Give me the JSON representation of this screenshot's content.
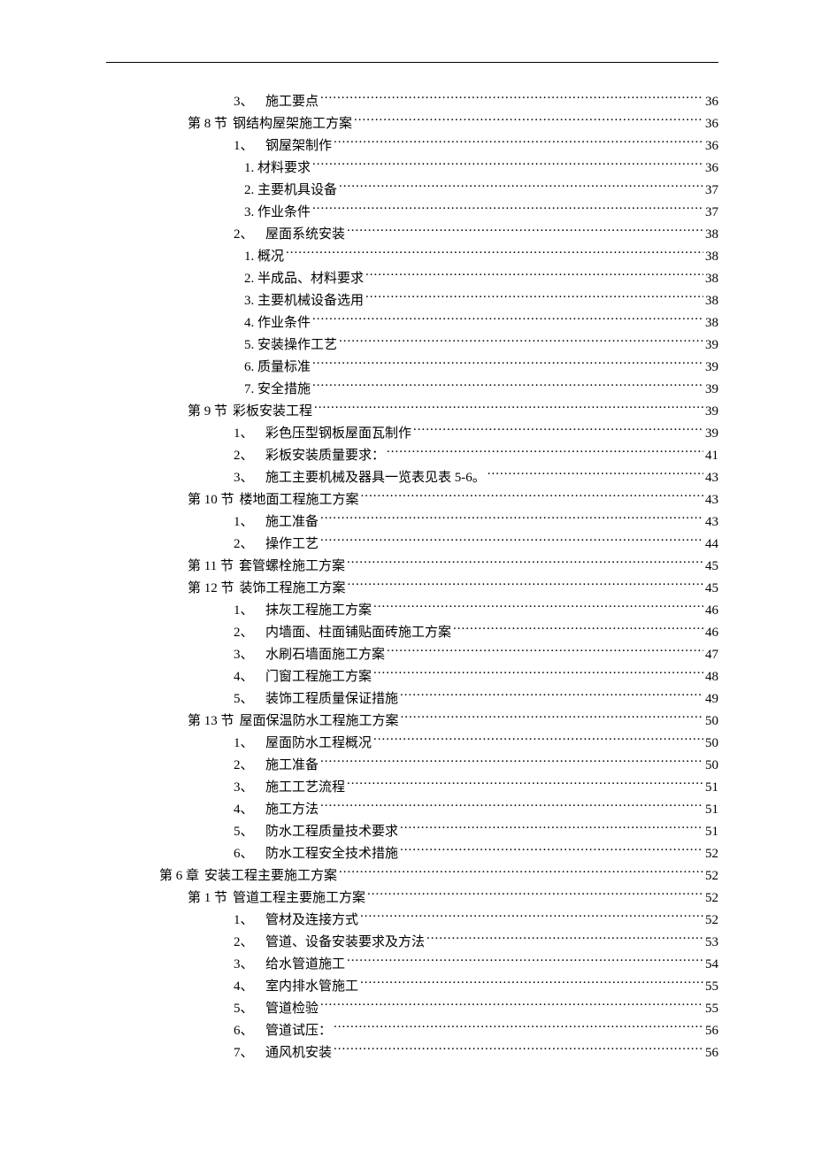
{
  "toc": [
    {
      "level": "l2b",
      "prefix": "3、",
      "title": "施工要点",
      "page": "36"
    },
    {
      "level": "l1",
      "prefix": "第 8 节",
      "title": "钢结构屋架施工方案",
      "page": "36"
    },
    {
      "level": "l2b",
      "prefix": "1、",
      "title": "钢屋架制作",
      "page": "36"
    },
    {
      "level": "l3",
      "prefix": "",
      "title": "1. 材料要求",
      "page": "36"
    },
    {
      "level": "l3",
      "prefix": "",
      "title": "2. 主要机具设备",
      "page": "37"
    },
    {
      "level": "l3",
      "prefix": "",
      "title": "3. 作业条件",
      "page": "37"
    },
    {
      "level": "l2b",
      "prefix": "2、",
      "title": "屋面系统安装",
      "page": "38"
    },
    {
      "level": "l3",
      "prefix": "",
      "title": "1. 概况",
      "page": "38"
    },
    {
      "level": "l3",
      "prefix": "",
      "title": "2. 半成品、材料要求",
      "page": "38"
    },
    {
      "level": "l3",
      "prefix": "",
      "title": "3. 主要机械设备选用",
      "page": "38"
    },
    {
      "level": "l3",
      "prefix": "",
      "title": "4. 作业条件",
      "page": "38"
    },
    {
      "level": "l3",
      "prefix": "",
      "title": "5. 安装操作工艺",
      "page": "39"
    },
    {
      "level": "l3",
      "prefix": "",
      "title": "6. 质量标准",
      "page": "39"
    },
    {
      "level": "l3",
      "prefix": "",
      "title": "7. 安全措施",
      "page": "39"
    },
    {
      "level": "l1",
      "prefix": "第 9 节",
      "title": "彩板安装工程",
      "page": "39"
    },
    {
      "level": "l2b",
      "prefix": "1、",
      "title": "彩色压型钢板屋面瓦制作",
      "page": "39"
    },
    {
      "level": "l2b",
      "prefix": "2、",
      "title": "彩板安装质量要求：",
      "page": "41"
    },
    {
      "level": "l2b",
      "prefix": "3、",
      "title": "施工主要机械及器具一览表见表 5-6。",
      "page": "43"
    },
    {
      "level": "l1",
      "prefix": "第 10 节",
      "title": "楼地面工程施工方案",
      "page": "43"
    },
    {
      "level": "l2b",
      "prefix": "1、",
      "title": "施工准备",
      "page": "43"
    },
    {
      "level": "l2b",
      "prefix": "2、",
      "title": "操作工艺",
      "page": "44"
    },
    {
      "level": "l1",
      "prefix": "第 11 节",
      "title": "套管螺栓施工方案",
      "page": "45"
    },
    {
      "level": "l1",
      "prefix": "第 12 节",
      "title": "装饰工程施工方案",
      "page": "45"
    },
    {
      "level": "l2b",
      "prefix": "1、",
      "title": "抹灰工程施工方案",
      "page": "46"
    },
    {
      "level": "l2b",
      "prefix": "2、",
      "title": "内墙面、柱面铺贴面砖施工方案",
      "page": "46"
    },
    {
      "level": "l2b",
      "prefix": "3、",
      "title": "水刷石墙面施工方案",
      "page": "47"
    },
    {
      "level": "l2b",
      "prefix": "4、",
      "title": "门窗工程施工方案",
      "page": "48"
    },
    {
      "level": "l2b",
      "prefix": "5、",
      "title": "装饰工程质量保证措施",
      "page": "49"
    },
    {
      "level": "l1",
      "prefix": "第 13 节",
      "title": "屋面保温防水工程施工方案",
      "page": "50"
    },
    {
      "level": "l2b",
      "prefix": "1、",
      "title": "屋面防水工程概况",
      "page": "50"
    },
    {
      "level": "l2b",
      "prefix": "2、",
      "title": "施工准备",
      "page": "50"
    },
    {
      "level": "l2b",
      "prefix": "3、",
      "title": "施工工艺流程",
      "page": "51"
    },
    {
      "level": "l2b",
      "prefix": "4、",
      "title": "施工方法",
      "page": "51"
    },
    {
      "level": "l2b",
      "prefix": "5、",
      "title": "防水工程质量技术要求",
      "page": "51"
    },
    {
      "level": "l2b",
      "prefix": "6、",
      "title": "防水工程安全技术措施",
      "page": "52"
    },
    {
      "level": "l0",
      "prefix": "第 6 章",
      "title": "安装工程主要施工方案",
      "page": "52"
    },
    {
      "level": "l1",
      "prefix": "第 1 节",
      "title": "管道工程主要施工方案",
      "page": "52"
    },
    {
      "level": "l2b",
      "prefix": "1、",
      "title": "管材及连接方式",
      "page": "52"
    },
    {
      "level": "l2b",
      "prefix": "2、",
      "title": "管道、设备安装要求及方法",
      "page": "53"
    },
    {
      "level": "l2b",
      "prefix": "3、",
      "title": "给水管道施工",
      "page": "54"
    },
    {
      "level": "l2b",
      "prefix": "4、",
      "title": "室内排水管施工",
      "page": "55"
    },
    {
      "level": "l2b",
      "prefix": "5、",
      "title": "管道检验",
      "page": "55"
    },
    {
      "level": "l2b",
      "prefix": "6、",
      "title": "管道试压：",
      "page": "56"
    },
    {
      "level": "l2b",
      "prefix": "7、",
      "title": "通风机安装",
      "page": "56"
    }
  ]
}
